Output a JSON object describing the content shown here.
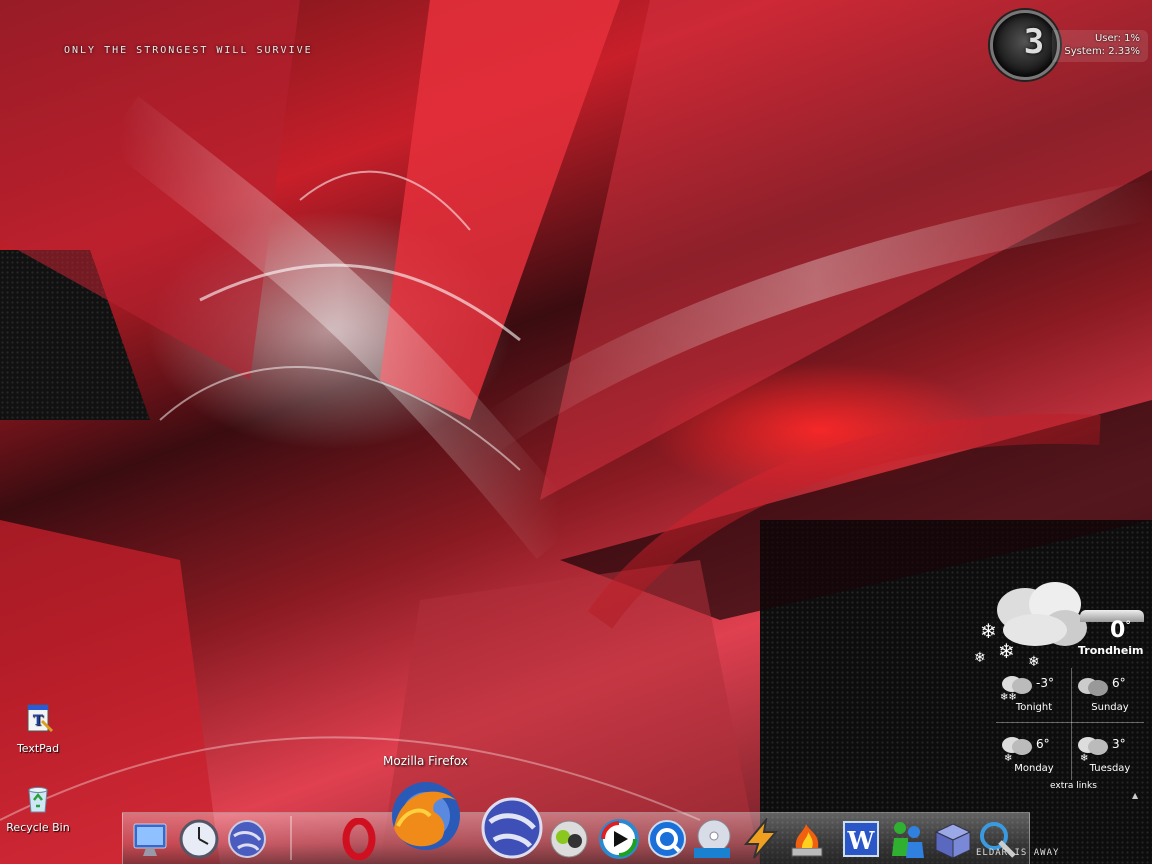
{
  "desktop": {
    "tagline": "ONLY THE STRONGEST WILL SURVIVE",
    "icons": [
      {
        "label": "TextPad",
        "icon": "textpad-icon"
      },
      {
        "label": "Recycle Bin",
        "icon": "recycle-bin-icon"
      }
    ]
  },
  "cpu_meter": {
    "digit": "3",
    "user_label": "User: 1%",
    "system_label": "System: 2.33%"
  },
  "weather": {
    "current_temp": "0",
    "degree_symbol": "°",
    "city": "Trondheim",
    "forecast": [
      {
        "day": "Tonight",
        "temp": "-3°",
        "icon": "snow-cloud-icon"
      },
      {
        "day": "Sunday",
        "temp": "6°",
        "icon": "cloud-icon"
      },
      {
        "day": "Monday",
        "temp": "6°",
        "icon": "snow-cloud-icon"
      },
      {
        "day": "Tuesday",
        "temp": "3°",
        "icon": "snow-cloud-icon"
      }
    ],
    "extra_links": "extra links",
    "arrow": "▲"
  },
  "dock": {
    "tooltip": "Mozilla Firefox",
    "brand_text": "ELDAR IS AWAY",
    "items": [
      "my-computer-icon",
      "clock-icon",
      "internet-globe-icon",
      "opera-icon",
      "firefox-icon",
      "globe-icon",
      "chat-icon",
      "media-player-icon",
      "quicktime-icon",
      "dvd-icon",
      "winamp-icon",
      "burner-icon",
      "word-icon",
      "messenger-icon",
      "package-icon",
      "tools-icon"
    ]
  }
}
